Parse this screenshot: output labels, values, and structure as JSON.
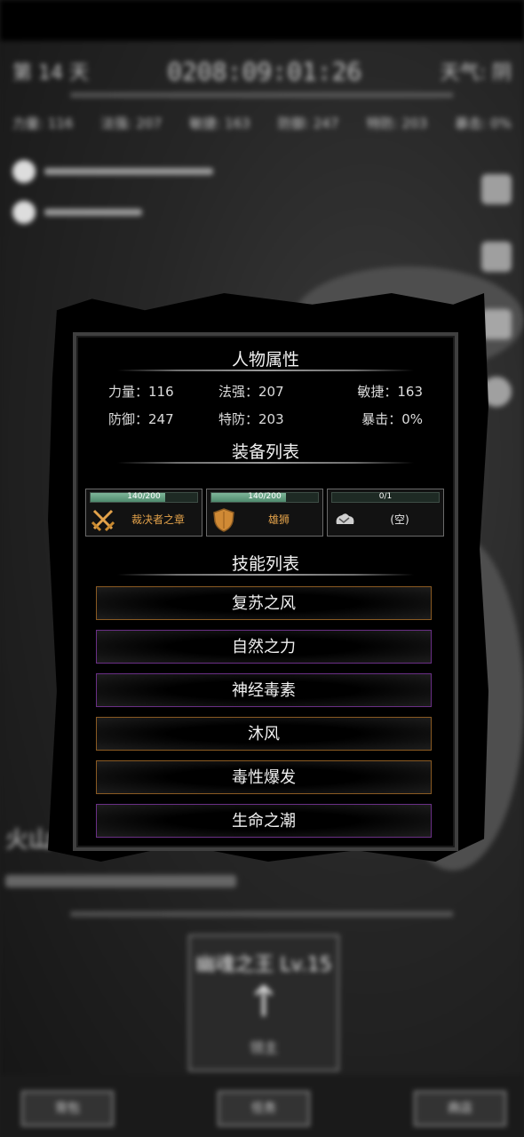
{
  "background": {
    "day": "第 14 天",
    "clock": "0208:09:01:26",
    "weather": "天气: 阴",
    "stats": [
      "力量: 116",
      "法强: 207",
      "敏捷: 163",
      "防御: 247",
      "特防: 203",
      "暴击: 0%"
    ],
    "location": "火山",
    "boss": {
      "title": "幽魂之王 Lv.15",
      "subtitle": "领主"
    },
    "bottom_buttons": [
      "背包",
      "任务",
      "商店"
    ]
  },
  "modal": {
    "attributes_title": "人物属性",
    "attributes": [
      {
        "label": "力量",
        "value": "116"
      },
      {
        "label": "法强",
        "value": "207"
      },
      {
        "label": "敏捷",
        "value": "163"
      },
      {
        "label": "防御",
        "value": "247"
      },
      {
        "label": "特防",
        "value": "203"
      },
      {
        "label": "暴击",
        "value": "0%"
      }
    ],
    "attributes_text": [
      "力量：116",
      "法强：207",
      "敏捷：163",
      "防御：247",
      "特防：203",
      "暴击：0%"
    ],
    "equipment_title": "装备列表",
    "equipment": [
      {
        "name": "裁决者之章",
        "durability": "140/200",
        "durability_fraction": 0.7,
        "icon": "crossed-swords-icon",
        "color": "#e3a24a"
      },
      {
        "name": "雄狮",
        "durability": "140/200",
        "durability_fraction": 0.7,
        "icon": "shield-icon",
        "color": "#e3a24a"
      },
      {
        "name": "(空)",
        "durability": "0/1",
        "durability_fraction": 0,
        "icon": "empty-slot-icon",
        "color": "#e8e8e8"
      }
    ],
    "skills_title": "技能列表",
    "skills": [
      {
        "name": "复苏之风",
        "border": "#8a5a22"
      },
      {
        "name": "自然之力",
        "border": "#6a2f86"
      },
      {
        "name": "神经毒素",
        "border": "#6a2f86"
      },
      {
        "name": "沐风",
        "border": "#8a5a22"
      },
      {
        "name": "毒性爆发",
        "border": "#8a5a22"
      },
      {
        "name": "生命之潮",
        "border": "#6a2f86"
      }
    ]
  }
}
